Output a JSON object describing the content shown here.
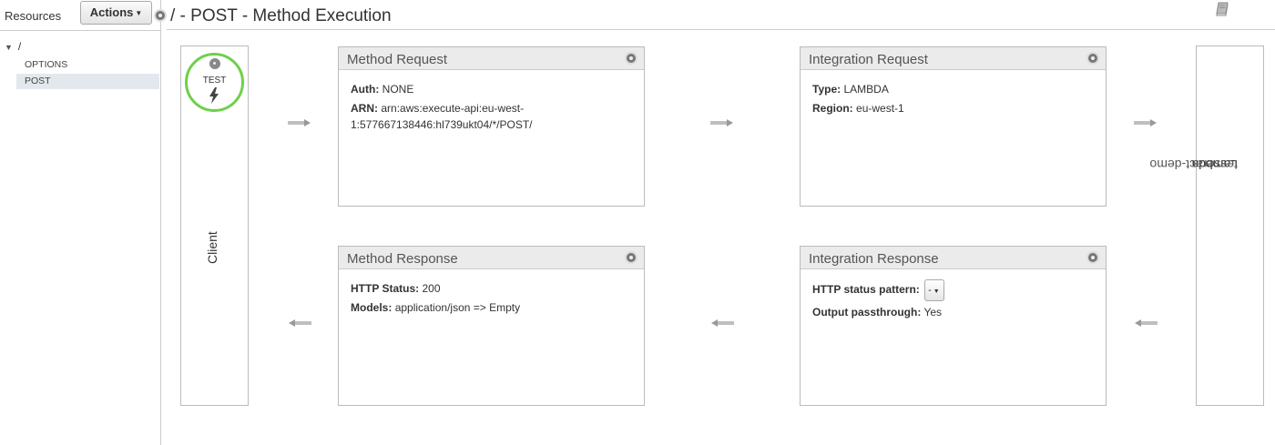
{
  "sidebar": {
    "resources_label": "Resources",
    "actions_label": "Actions",
    "tree_root": "/",
    "methods": [
      "OPTIONS",
      "POST"
    ]
  },
  "page_title": "/ - POST - Method Execution",
  "client": {
    "test_label": "TEST",
    "label": "Client"
  },
  "method_request": {
    "title": "Method Request",
    "auth_label": "Auth:",
    "auth_value": "NONE",
    "arn_label": "ARN:",
    "arn_value": "arn:aws:execute-api:eu-west-1:577667138446:hl739ukt04/*/POST/"
  },
  "integration_request": {
    "title": "Integration Request",
    "type_label": "Type:",
    "type_value": "LAMBDA",
    "region_label": "Region:",
    "region_value": "eu-west-1"
  },
  "method_response": {
    "title": "Method Response",
    "status_label": "HTTP Status:",
    "status_value": "200",
    "models_label": "Models:",
    "models_value": "application/json => Empty"
  },
  "integration_response": {
    "title": "Integration Response",
    "pattern_label": "HTTP status pattern:",
    "pattern_value": "-",
    "passthrough_label": "Output passthrough:",
    "passthrough_value": "Yes"
  },
  "lambda": {
    "label": "Lambda",
    "function_name": "tesseract-demo"
  },
  "colors": {
    "test_ring": "#6ed04a",
    "panel_header": "#ebebeb",
    "selected_row": "#e3e8ee"
  }
}
